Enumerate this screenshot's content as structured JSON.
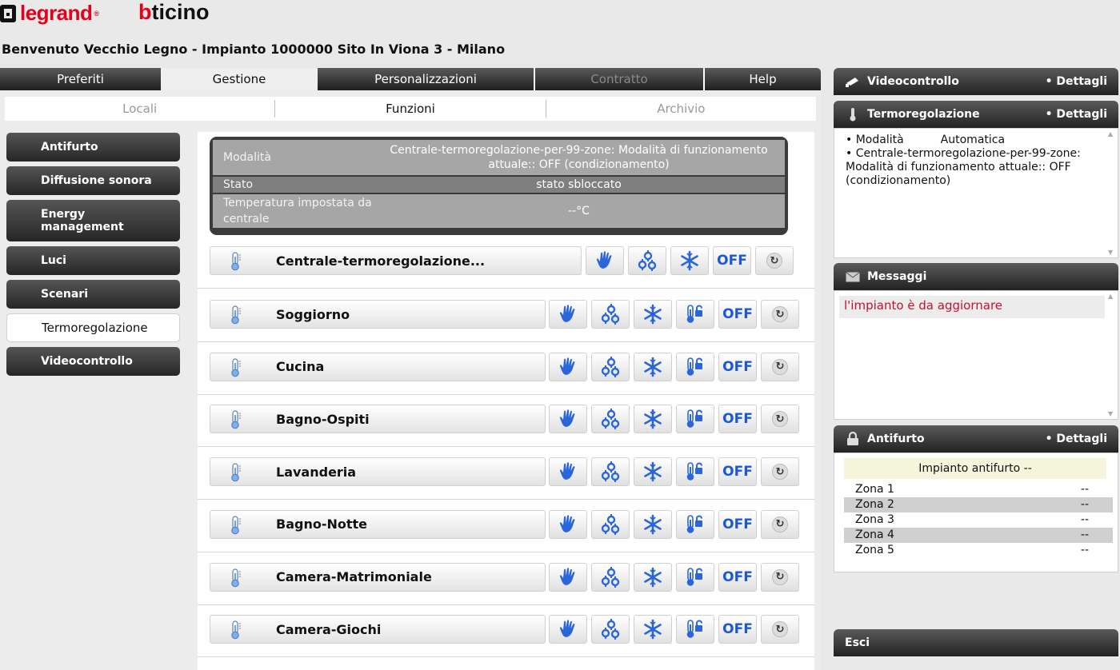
{
  "brand": {
    "legrand": "legrand",
    "legrand_reg": "®",
    "bticino_b": "b",
    "bticino_rest": "ticino"
  },
  "welcome": "Benvenuto Vecchio Legno - Impianto 1000000 Sito In Viona 3 - Milano",
  "main_tabs": [
    {
      "label": "Preferiti"
    },
    {
      "label": "Gestione"
    },
    {
      "label": "Personalizzazioni"
    },
    {
      "label": "Contratto"
    },
    {
      "label": "Help"
    }
  ],
  "sub_tabs": [
    {
      "label": "Locali"
    },
    {
      "label": "Funzioni"
    },
    {
      "label": "Archivio"
    }
  ],
  "side_menu": [
    {
      "label": "Antifurto"
    },
    {
      "label": "Diffusione sonora"
    },
    {
      "label": "Energy\nmanagement"
    },
    {
      "label": "Luci"
    },
    {
      "label": "Scenari"
    },
    {
      "label": "Termoregolazione"
    },
    {
      "label": "Videocontrollo"
    }
  ],
  "summary": {
    "rows": [
      {
        "key": "Modalità",
        "value": "Centrale-termoregolazione-per-99-zone: Modalità di funzionamento attuale:: OFF (condizionamento)"
      },
      {
        "key": "Stato",
        "value": "stato sbloccato"
      },
      {
        "key": "Temperatura impostata da centrale",
        "value": "--°C"
      }
    ]
  },
  "zones": [
    {
      "name": "Centrale-termoregolazione...",
      "off_label": "OFF"
    },
    {
      "name": "Soggiorno",
      "off_label": "OFF"
    },
    {
      "name": "Cucina",
      "off_label": "OFF"
    },
    {
      "name": "Bagno-Ospiti",
      "off_label": "OFF"
    },
    {
      "name": "Lavanderia",
      "off_label": "OFF"
    },
    {
      "name": "Bagno-Notte",
      "off_label": "OFF"
    },
    {
      "name": "Camera-Matrimoniale",
      "off_label": "OFF"
    },
    {
      "name": "Camera-Giochi",
      "off_label": "OFF"
    }
  ],
  "right": {
    "videocontrollo": {
      "title": "Videocontrollo",
      "details": "• Dettagli"
    },
    "termoregolazione": {
      "title": "Termoregolazione",
      "details": "• Dettagli",
      "line1_label": "• Modalità",
      "line1_value": "Automatica",
      "line2": "• Centrale-termoregolazione-per-99-zone: Modalità di funzionamento attuale:: OFF (condizionamento)"
    },
    "messaggi": {
      "title": "Messaggi",
      "message": "l'impianto è da aggiornare"
    },
    "antifurto": {
      "title": "Antifurto",
      "details": "• Dettagli",
      "header": "Impianto antifurto --",
      "zones": [
        {
          "name": "Zona 1",
          "value": "--"
        },
        {
          "name": "Zona 2",
          "value": "--"
        },
        {
          "name": "Zona 3",
          "value": "--"
        },
        {
          "name": "Zona 4",
          "value": "--"
        },
        {
          "name": "Zona 5",
          "value": "--"
        }
      ]
    },
    "esci": "Esci"
  },
  "colors": {
    "accent_blue": "#1b58d6",
    "brand_red": "#e2001a",
    "message_red": "#c8102e"
  },
  "icons": [
    "thermometer-icon",
    "hand-icon",
    "gears-icon",
    "snowflake-icon",
    "thermo-lock-icon",
    "refresh-icon",
    "camera-icon",
    "envelope-icon",
    "padlock-icon"
  ]
}
